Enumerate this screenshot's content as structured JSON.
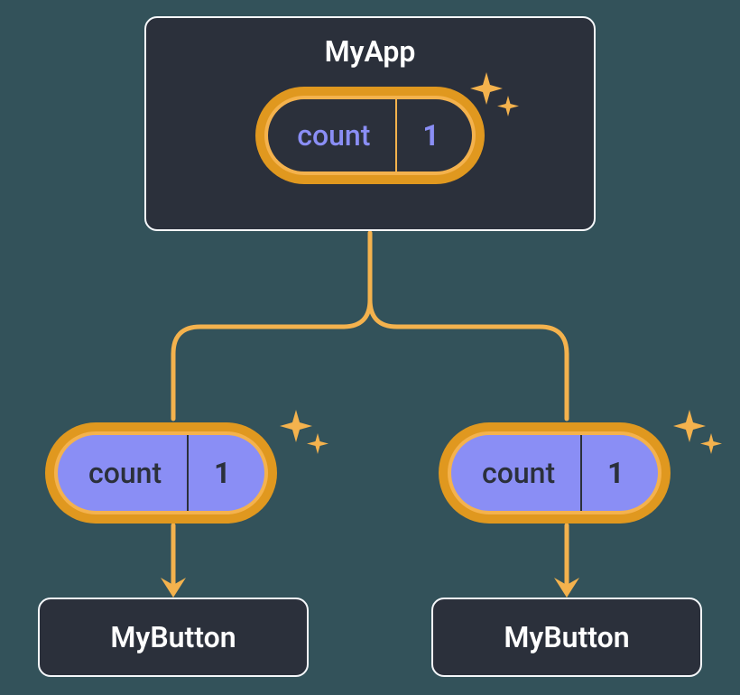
{
  "colors": {
    "background": "#33525a",
    "box_bg": "#2b303b",
    "box_border": "#f5f7fa",
    "pill_outer": "#e0981f",
    "pill_border": "#f4b24d",
    "pill_text_dark": "#8a8ef5",
    "light_pill_bg": "#8a8ef5",
    "light_pill_text": "#2b303b",
    "connector": "#f4b24d"
  },
  "parent": {
    "title": "MyApp",
    "state_label": "count",
    "state_value": "1"
  },
  "children": [
    {
      "prop_label": "count",
      "prop_value": "1",
      "leaf_label": "MyButton"
    },
    {
      "prop_label": "count",
      "prop_value": "1",
      "leaf_label": "MyButton"
    }
  ]
}
